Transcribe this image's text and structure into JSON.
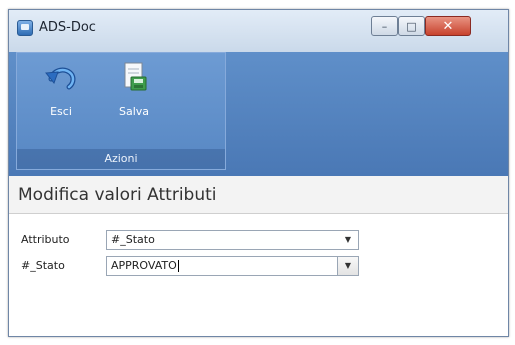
{
  "window": {
    "title": "ADS-Doc",
    "controls": {
      "minimize": "–",
      "maximize": "□",
      "close": "✕"
    }
  },
  "ribbon": {
    "group_label": "Azioni",
    "buttons": [
      {
        "label": "Esci",
        "icon": "undo-arrow-icon"
      },
      {
        "label": "Salva",
        "icon": "save-document-icon"
      }
    ]
  },
  "section": {
    "title": "Modifica valori Attributi"
  },
  "form": {
    "attributo_label": "Attributo",
    "attributo_value": "#_Stato",
    "stato_label": "#_Stato",
    "stato_value": "APPROVATO",
    "dropdown_arrow": "▼"
  },
  "colors": {
    "ribbon": "#4f7fbe",
    "ribbon_group": "#6293cf",
    "titlebar": "#d6e2f0",
    "close_button": "#d0533d"
  }
}
